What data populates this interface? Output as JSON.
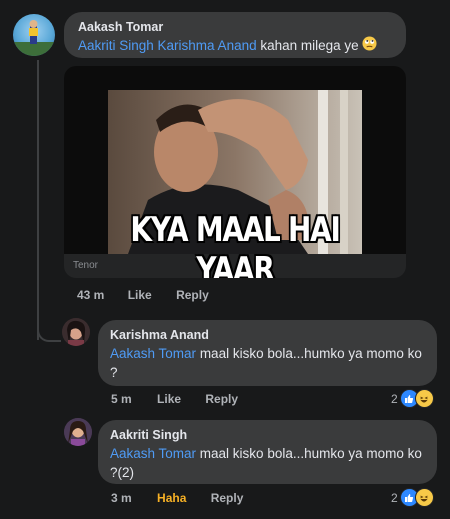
{
  "colors": {
    "background": "#18191a",
    "bubble": "#3a3b3c",
    "mention": "#4f9bf5",
    "haha": "#f7b125",
    "meta": "#b0b3b8"
  },
  "comments": [
    {
      "author": "Aakash Tomar",
      "mentions": "Aakriti Singh Karishma Anand",
      "text": "kahan milega ye",
      "emoji": "rolling-eyes-emoji",
      "gif": {
        "caption": "KYA MAAL HAI YAAR",
        "provider": "Tenor"
      },
      "time": "43 m",
      "like": "Like",
      "reply": "Reply"
    }
  ],
  "replies": [
    {
      "author": "Karishma Anand",
      "mention": "Aakash Tomar",
      "text": "maal kisko bola...humko ya momo ko ?",
      "time": "5 m",
      "like": "Like",
      "reply": "Reply",
      "reaction_count": "2",
      "reactions": [
        "like-icon",
        "haha-icon"
      ]
    },
    {
      "author": "Aakriti Singh",
      "mention": "Aakash Tomar",
      "text": " maal kisko bola...humko ya momo ko ?(2)",
      "time": "3 m",
      "like": "Haha",
      "reply": "Reply",
      "reaction_count": "2",
      "reactions": [
        "like-icon",
        "haha-icon"
      ]
    }
  ]
}
